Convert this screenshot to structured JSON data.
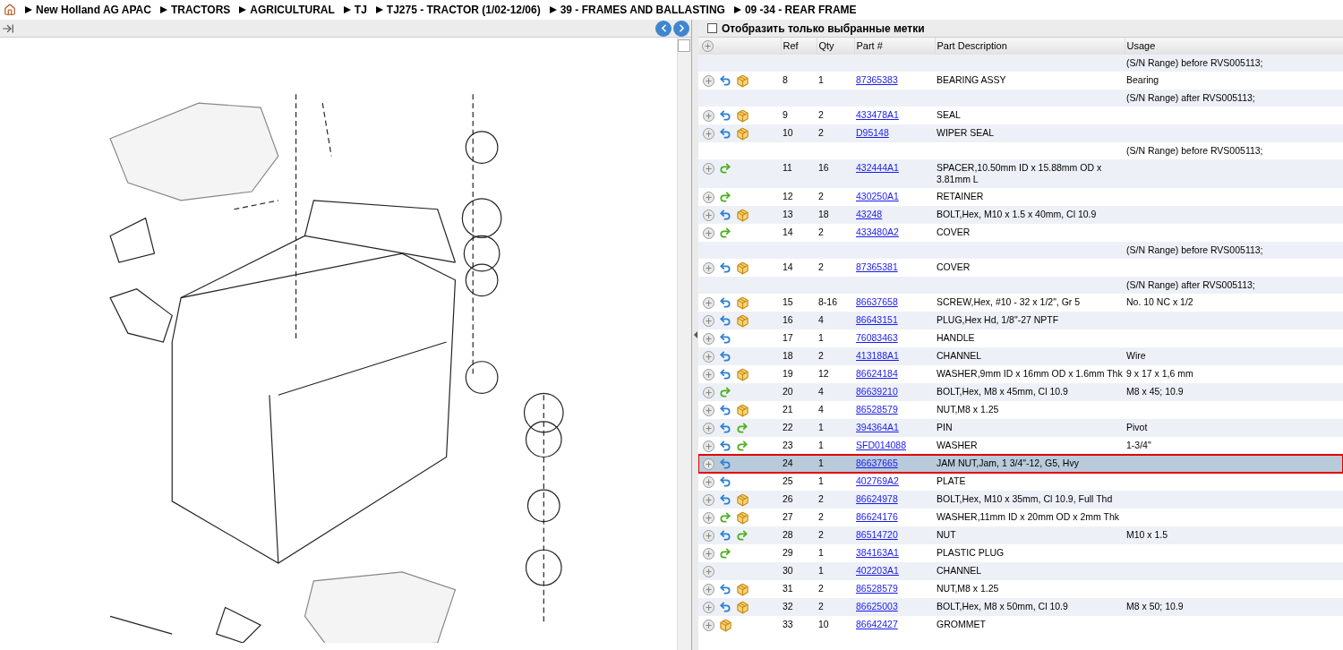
{
  "breadcrumb": [
    "New Holland AG APAC",
    "TRACTORS",
    "AGRICULTURAL",
    "TJ",
    "TJ275 - TRACTOR (1/02-12/06)",
    "39 - FRAMES AND BALLASTING",
    "09 -34 - REAR FRAME"
  ],
  "filter": {
    "label": "Отобразить только выбранные метки",
    "checked": false
  },
  "table": {
    "columns": [
      "Ref",
      "Qty",
      "Part #",
      "Part Description",
      "Usage"
    ],
    "rows": [
      {
        "kind": "note",
        "usage": "(S/N Range) before RVS005113;"
      },
      {
        "kind": "part",
        "return_arrow": true,
        "forward_arrow": false,
        "package": true,
        "ref": "8",
        "qty": "1",
        "part": "87365383",
        "description": "BEARING ASSY",
        "usage": "Bearing",
        "selected": false
      },
      {
        "kind": "note",
        "usage": "(S/N Range) after RVS005113;"
      },
      {
        "kind": "part",
        "return_arrow": true,
        "forward_arrow": false,
        "package": true,
        "ref": "9",
        "qty": "2",
        "part": "433478A1",
        "description": "SEAL",
        "usage": "",
        "selected": false
      },
      {
        "kind": "part",
        "return_arrow": true,
        "forward_arrow": false,
        "package": true,
        "ref": "10",
        "qty": "2",
        "part": "D95148",
        "description": "WIPER SEAL",
        "usage": "",
        "selected": false
      },
      {
        "kind": "note",
        "usage": "(S/N Range) before RVS005113;"
      },
      {
        "kind": "part",
        "return_arrow": false,
        "forward_arrow": true,
        "package": false,
        "ref": "11",
        "qty": "16",
        "part": "432444A1",
        "description": "SPACER,10.50mm ID x 15.88mm OD x 3.81mm L",
        "usage": "",
        "selected": false
      },
      {
        "kind": "part",
        "return_arrow": false,
        "forward_arrow": true,
        "package": false,
        "ref": "12",
        "qty": "2",
        "part": "430250A1",
        "description": "RETAINER",
        "usage": "",
        "selected": false
      },
      {
        "kind": "part",
        "return_arrow": true,
        "forward_arrow": false,
        "package": true,
        "ref": "13",
        "qty": "18",
        "part": "43248",
        "description": "BOLT,Hex, M10 x 1.5 x 40mm, Cl 10.9",
        "usage": "",
        "selected": false
      },
      {
        "kind": "part",
        "return_arrow": false,
        "forward_arrow": true,
        "package": false,
        "ref": "14",
        "qty": "2",
        "part": "433480A2",
        "description": "COVER",
        "usage": "",
        "selected": false
      },
      {
        "kind": "note",
        "usage": "(S/N Range) before RVS005113;"
      },
      {
        "kind": "part",
        "return_arrow": true,
        "forward_arrow": false,
        "package": true,
        "ref": "14",
        "qty": "2",
        "part": "87365381",
        "description": "COVER",
        "usage": "",
        "selected": false
      },
      {
        "kind": "note",
        "usage": "(S/N Range) after RVS005113;"
      },
      {
        "kind": "part",
        "return_arrow": true,
        "forward_arrow": false,
        "package": true,
        "ref": "15",
        "qty": "8-16",
        "part": "86637658",
        "description": "SCREW,Hex, #10 - 32 x 1/2\", Gr 5",
        "usage": "No. 10 NC x 1/2",
        "selected": false
      },
      {
        "kind": "part",
        "return_arrow": true,
        "forward_arrow": false,
        "package": true,
        "ref": "16",
        "qty": "4",
        "part": "86643151",
        "description": "PLUG,Hex Hd, 1/8\"-27 NPTF",
        "usage": "",
        "selected": false
      },
      {
        "kind": "part",
        "return_arrow": true,
        "forward_arrow": false,
        "package": false,
        "ref": "17",
        "qty": "1",
        "part": "76083463",
        "description": "HANDLE",
        "usage": "",
        "selected": false
      },
      {
        "kind": "part",
        "return_arrow": true,
        "forward_arrow": false,
        "package": false,
        "ref": "18",
        "qty": "2",
        "part": "413188A1",
        "description": "CHANNEL",
        "usage": "Wire",
        "selected": false
      },
      {
        "kind": "part",
        "return_arrow": true,
        "forward_arrow": false,
        "package": true,
        "ref": "19",
        "qty": "12",
        "part": "86624184",
        "description": "WASHER,9mm ID x 16mm OD x 1.6mm Thk",
        "usage": "9 x 17 x 1,6 mm",
        "selected": false
      },
      {
        "kind": "part",
        "return_arrow": false,
        "forward_arrow": true,
        "package": false,
        "ref": "20",
        "qty": "4",
        "part": "86639210",
        "description": "BOLT,Hex, M8 x 45mm, Cl 10.9",
        "usage": "M8 x 45; 10.9",
        "selected": false
      },
      {
        "kind": "part",
        "return_arrow": true,
        "forward_arrow": false,
        "package": true,
        "ref": "21",
        "qty": "4",
        "part": "86528579",
        "description": "NUT,M8 x 1.25",
        "usage": "",
        "selected": false
      },
      {
        "kind": "part",
        "return_arrow": true,
        "forward_arrow": true,
        "package": false,
        "ref": "22",
        "qty": "1",
        "part": "394364A1",
        "description": "PIN",
        "usage": "Pivot",
        "selected": false
      },
      {
        "kind": "part",
        "return_arrow": true,
        "forward_arrow": true,
        "package": false,
        "ref": "23",
        "qty": "1",
        "part": "SFD014088",
        "description": "WASHER",
        "usage": "1-3/4\"",
        "selected": false
      },
      {
        "kind": "part",
        "return_arrow": true,
        "forward_arrow": false,
        "package": false,
        "ref": "24",
        "qty": "1",
        "part": "86637665",
        "description": "JAM NUT,Jam, 1 3/4\"-12, G5, Hvy",
        "usage": "",
        "selected": true
      },
      {
        "kind": "part",
        "return_arrow": true,
        "forward_arrow": false,
        "package": false,
        "ref": "25",
        "qty": "1",
        "part": "402769A2",
        "description": "PLATE",
        "usage": "",
        "selected": false
      },
      {
        "kind": "part",
        "return_arrow": true,
        "forward_arrow": false,
        "package": true,
        "ref": "26",
        "qty": "2",
        "part": "86624978",
        "description": "BOLT,Hex, M10 x 35mm, Cl 10.9, Full Thd",
        "usage": "",
        "selected": false
      },
      {
        "kind": "part",
        "return_arrow": false,
        "forward_arrow": true,
        "package": true,
        "ref": "27",
        "qty": "2",
        "part": "86624176",
        "description": "WASHER,11mm ID x 20mm OD x 2mm Thk",
        "usage": "",
        "selected": false
      },
      {
        "kind": "part",
        "return_arrow": true,
        "forward_arrow": true,
        "package": false,
        "ref": "28",
        "qty": "2",
        "part": "86514720",
        "description": "NUT",
        "usage": "M10 x 1.5",
        "selected": false
      },
      {
        "kind": "part",
        "return_arrow": false,
        "forward_arrow": true,
        "package": false,
        "ref": "29",
        "qty": "1",
        "part": "384163A1",
        "description": "PLASTIC PLUG",
        "usage": "",
        "selected": false
      },
      {
        "kind": "part",
        "return_arrow": false,
        "forward_arrow": false,
        "package": false,
        "ref": "30",
        "qty": "1",
        "part": "402203A1",
        "description": "CHANNEL",
        "usage": "",
        "selected": false
      },
      {
        "kind": "part",
        "return_arrow": true,
        "forward_arrow": false,
        "package": true,
        "ref": "31",
        "qty": "2",
        "part": "86528579",
        "description": "NUT,M8 x 1.25",
        "usage": "",
        "selected": false
      },
      {
        "kind": "part",
        "return_arrow": true,
        "forward_arrow": false,
        "package": true,
        "ref": "32",
        "qty": "2",
        "part": "86625003",
        "description": "BOLT,Hex, M8 x 50mm, Cl 10.9",
        "usage": "M8 x 50; 10.9",
        "selected": false
      },
      {
        "kind": "part",
        "return_arrow": false,
        "forward_arrow": false,
        "package": true,
        "ref": "33",
        "qty": "10",
        "part": "86642427",
        "description": "GROMMET",
        "usage": "",
        "selected": false
      }
    ]
  }
}
